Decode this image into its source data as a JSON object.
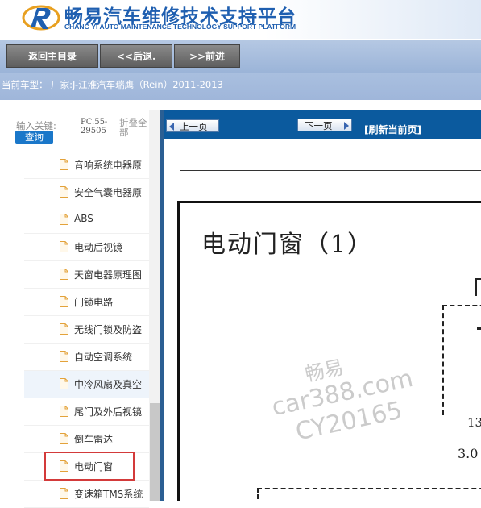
{
  "header": {
    "title_cn": "畅易汽车维修技术支持平台",
    "title_en": "CHANG YI AUTO MAINTENANCE TECHNOLOGY SUPPORT PLATFORM"
  },
  "nav": {
    "home_label": "返回主目录",
    "back_label": "<<后退.",
    "forward_label": ">>前进"
  },
  "current_model": {
    "text": "当前车型：  厂家:J-江淮汽车瑞鹰（Rein）2011-2013"
  },
  "search": {
    "keyword_label": "输入关键:",
    "keyword_value": "PC.55-29505",
    "collapse_label": "折叠全部",
    "query_label": "查询"
  },
  "tree": {
    "items": [
      {
        "label": "音响系统电器原"
      },
      {
        "label": "安全气囊电器原"
      },
      {
        "label": "ABS"
      },
      {
        "label": "电动后视镜"
      },
      {
        "label": "天窗电器原理图"
      },
      {
        "label": "门锁电路"
      },
      {
        "label": "无线门锁及防盗"
      },
      {
        "label": "自动空调系统"
      },
      {
        "label": "中冷风扇及真空"
      },
      {
        "label": "尾门及外后视镜"
      },
      {
        "label": "倒车雷达"
      },
      {
        "label": "电动门窗"
      },
      {
        "label": "变速箱TMS系统"
      }
    ]
  },
  "pager": {
    "prev_label": "上一页",
    "next_label": "下一页",
    "refresh_label": "[刷新当前页]"
  },
  "document": {
    "title": "电动门窗（1）",
    "mark_13": "13",
    "mark_3": "3.0"
  },
  "watermark": {
    "line1": "畅易",
    "line2": "car388.com",
    "line3": "CY20165"
  },
  "colors": {
    "brand_blue": "#1f5fb0",
    "panel_blue": "#0b5a9e",
    "highlight_red": "#d33a3a"
  }
}
